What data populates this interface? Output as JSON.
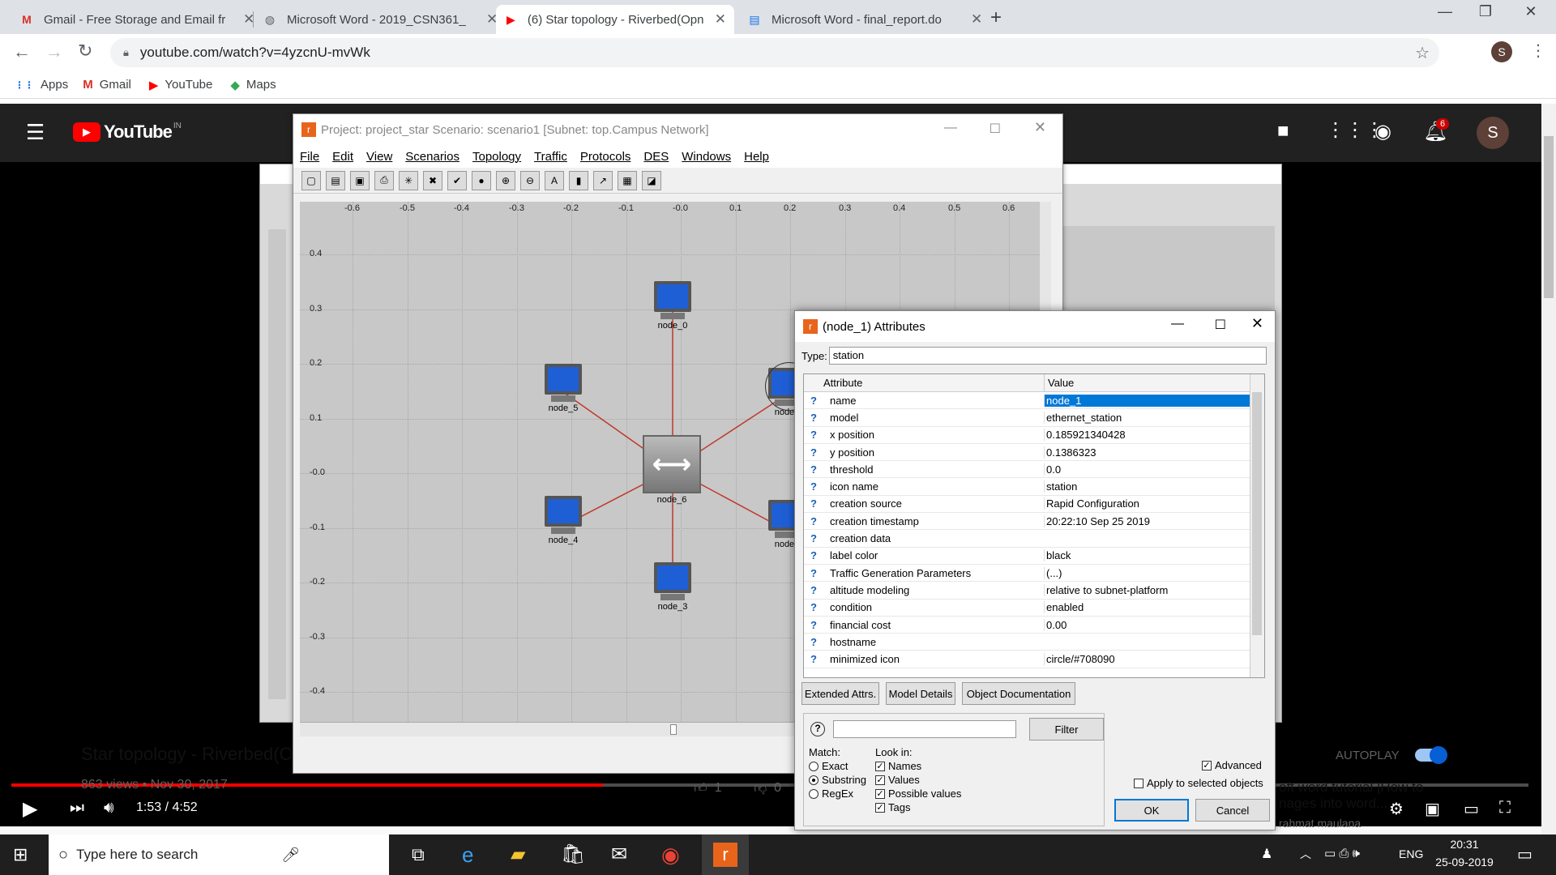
{
  "browser": {
    "tabs": [
      {
        "favicon": "M",
        "title": "Gmail - Free Storage and Email fr",
        "active": false
      },
      {
        "favicon": "◍",
        "title": "Microsoft Word - 2019_CSN361_",
        "active": false
      },
      {
        "favicon": "▶",
        "title": "(6) Star topology - Riverbed(Opn",
        "active": true
      },
      {
        "favicon": "▤",
        "title": "Microsoft Word - final_report.do",
        "active": false
      }
    ],
    "url": "youtube.com/watch?v=4yzcnU-mvWk",
    "profile_initial": "S",
    "bookmarks": [
      {
        "icon": "⋮⋮",
        "label": "Apps"
      },
      {
        "icon": "M",
        "label": "Gmail"
      },
      {
        "icon": "▶",
        "label": "YouTube"
      },
      {
        "icon": "◆",
        "label": "Maps"
      }
    ]
  },
  "youtube": {
    "logo": "YouTube",
    "region": "IN",
    "notif_count": "6",
    "avatar": "S",
    "video_title": "Star topology - Riverbed(O",
    "meta": "863 views • Nov 30, 2017",
    "likes": "1",
    "dislikes": "0",
    "time": "1:53 / 4:52",
    "autoplay": "AUTOPLAY",
    "progress_fraction": 0.39,
    "rec_title_1": "oft word tutorial |How to",
    "rec_title_2": "nages into word...",
    "rec_channel": "rahmat maulana"
  },
  "opnet": {
    "title": "Project: project_star Scenario: scenario1  [Subnet: top.Campus Network]",
    "menu": [
      "File",
      "Edit",
      "View",
      "Scenarios",
      "Topology",
      "Traffic",
      "Protocols",
      "DES",
      "Windows",
      "Help"
    ],
    "x_ticks": [
      "-0.6",
      "-0.5",
      "-0.4",
      "-0.3",
      "-0.2",
      "-0.1",
      "-0.0",
      "0.1",
      "0.2",
      "0.3",
      "0.4",
      "0.5",
      "0.6"
    ],
    "y_ticks": [
      "0.4",
      "0.3",
      "0.2",
      "0.1",
      "-0.0",
      "-0.1",
      "-0.2",
      "-0.3",
      "-0.4"
    ],
    "nodes": {
      "n0": "node_0",
      "n1": "node_",
      "n2": "node_",
      "n3": "node_3",
      "n4": "node_4",
      "n5": "node_5",
      "n6": "node_6"
    }
  },
  "attributes": {
    "title": "(node_1) Attributes",
    "type_label": "Type:",
    "type_value": "station",
    "col_attribute": "Attribute",
    "col_value": "Value",
    "rows": [
      {
        "name": "name",
        "value": "node_1",
        "selected": true
      },
      {
        "name": "model",
        "value": "ethernet_station"
      },
      {
        "name": "x position",
        "value": "0.185921340428"
      },
      {
        "name": "y position",
        "value": "0.1386323"
      },
      {
        "name": "threshold",
        "value": "0.0"
      },
      {
        "name": "icon name",
        "value": "station"
      },
      {
        "name": "creation source",
        "value": "Rapid Configuration"
      },
      {
        "name": "creation timestamp",
        "value": "20:22:10 Sep 25 2019"
      },
      {
        "name": "creation data",
        "value": ""
      },
      {
        "name": "label color",
        "value": "black"
      },
      {
        "name": "Traffic Generation Parameters",
        "value": "(...)"
      },
      {
        "name": "altitude modeling",
        "value": "relative to subnet-platform"
      },
      {
        "name": "condition",
        "value": "enabled"
      },
      {
        "name": "financial cost",
        "value": "0.00"
      },
      {
        "name": "hostname",
        "value": ""
      },
      {
        "name": "minimized icon",
        "value": "circle/#708090"
      }
    ],
    "btn_extended": "Extended Attrs.",
    "btn_model": "Model Details",
    "btn_object": "Object Documentation",
    "btn_filter": "Filter",
    "match_label": "Match:",
    "match_exact": "Exact",
    "match_substring": "Substring",
    "match_regex": "RegEx",
    "lookin_label": "Look in:",
    "lookin_names": "Names",
    "lookin_values": "Values",
    "lookin_possible": "Possible values",
    "lookin_tags": "Tags",
    "advanced": "Advanced",
    "apply_selected": "Apply to selected objects",
    "ok": "OK",
    "cancel": "Cancel"
  },
  "taskbar": {
    "search_placeholder": "Type here to search",
    "lang": "ENG",
    "time": "20:31",
    "date": "25-09-2019"
  },
  "colors": {
    "yt_red": "#ff0000",
    "link_line": "#c0392b",
    "selection": "#0078d7"
  }
}
